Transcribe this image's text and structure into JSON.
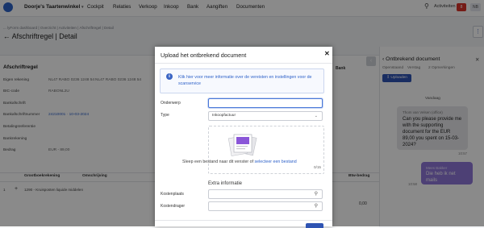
{
  "topbar": {
    "company": "Doorje's Taartenwinkel",
    "nav": [
      "Cockpit",
      "Relaties",
      "Verkoop",
      "Inkoop",
      "Bank",
      "Aangiften",
      "Documenten"
    ],
    "activities_label": "Activiteiten",
    "badge": "8",
    "avatar": "NB"
  },
  "page": {
    "breadcrumb": "... lyForm dashboard | Overzicht | Activiteiten | Afschriftregel | Detail",
    "title": "← Afschriftregel | Detail",
    "more": "⋮"
  },
  "details": {
    "section_title": "Afschriftregel",
    "bank_heading": "Bank",
    "rows": [
      {
        "label": "Eigen rekening",
        "value": "NL47 RABO 0236 1248 54",
        "value2": "NL47 RABO 0236 1248 54"
      },
      {
        "label": "BIC-code",
        "value": "RABONL2U",
        "value2": ""
      },
      {
        "label": "Bankafschrift",
        "value": "",
        "value2": ""
      },
      {
        "label": "Bankafschriftnummer",
        "value": "24210001 · 10-03-2024",
        "value2": ""
      },
      {
        "label": "Betalingsreferentie",
        "value": "",
        "value2": ""
      },
      {
        "label": "Bankrekening",
        "value": "",
        "value2": ""
      },
      {
        "label": "Bedrag",
        "value": "EUR - 89,00",
        "value2": ""
      }
    ],
    "table_headers": [
      "Grootboekrekening",
      "Omschrijving",
      "Btw-bedrag"
    ],
    "table_row": "1290 - Kruisposten liquide middelen",
    "amount": "0,00"
  },
  "chat": {
    "title": "Ontbrekend document",
    "tabs": [
      "Openstaand",
      "Verstag",
      "2 Opmerkingen"
    ],
    "upload_label": "Uploaden",
    "date": "Vandaag",
    "messages": [
      {
        "sender": "Thom van Velsen (office)",
        "body": "Can you please provide me with the supporting document for the EUR 89,00 you spent on 15-03-2024?",
        "time": "10:57"
      },
      {
        "sender": "Mees Bakker",
        "body": "Die heb ik net mails",
        "time": "10:58"
      }
    ]
  },
  "modal": {
    "title": "Upload het ontbrekend document",
    "info": "Klik hier voor meer informatie over de vereisten en instellingen voor de scanservice",
    "subject_label": "Onderwerp",
    "subject_value": "",
    "type_label": "Type",
    "type_value": "Inkoopfactuur",
    "drop_text": "Sleep een bestand naar dit venster of ",
    "drop_link": "selecteer een bestand",
    "file_count": "0/15",
    "extra_title": "Extra informatie",
    "cost_center_label": "Kostenplaats",
    "cost_carrier_label": "Kostendrager"
  },
  "colors": {
    "accent": "#2f54b3",
    "link": "#2f62c9",
    "badge_red": "#d9332a",
    "chat_purple": "#8f76d9"
  }
}
